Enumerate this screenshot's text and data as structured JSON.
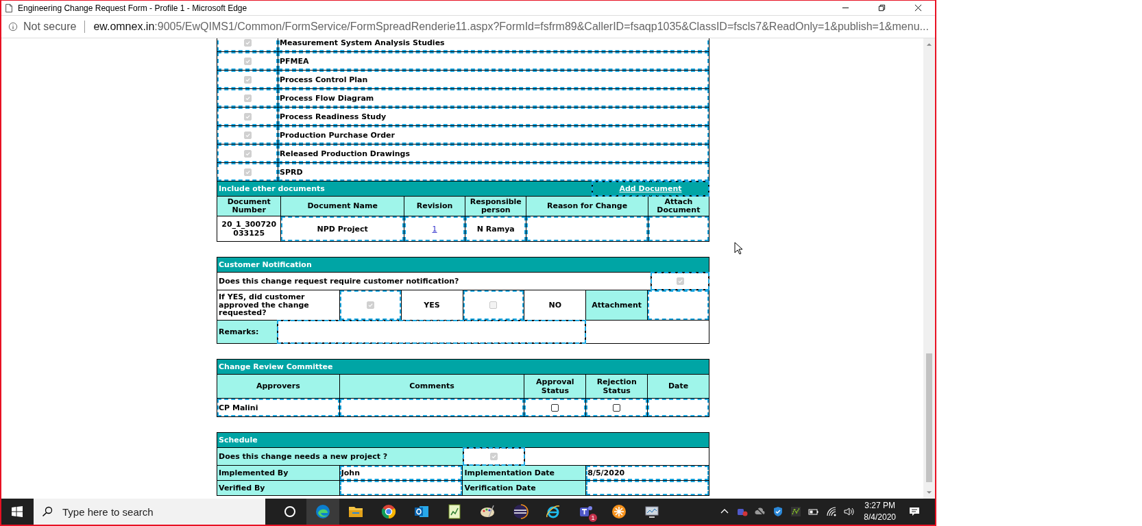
{
  "window": {
    "title": "Engineering Change Request Form - Profile 1 - Microsoft Edge"
  },
  "address_bar": {
    "security": "Not secure",
    "url_host": "ew.omnex.in",
    "url_path": ":9005/EwQIMS1/Common/FormService/FormSpreadRenderie11.aspx?FormId=fsfrm89&CallerID=fsaqp1035&ClassID=fscls7&ReadOnly=1&publish=1&menu..."
  },
  "checklist": [
    {
      "label": "Measurement System Analysis Studies",
      "checked": true,
      "disabled": true
    },
    {
      "label": "PFMEA",
      "checked": true,
      "disabled": true
    },
    {
      "label": "Process Control Plan",
      "checked": true,
      "disabled": true
    },
    {
      "label": "Process Flow Diagram",
      "checked": true,
      "disabled": true
    },
    {
      "label": "Process Readiness Study",
      "checked": true,
      "disabled": true
    },
    {
      "label": "Production Purchase Order",
      "checked": true,
      "disabled": true
    },
    {
      "label": "Released Production Drawings",
      "checked": true,
      "disabled": true
    },
    {
      "label": "SPRD",
      "checked": true,
      "disabled": true
    }
  ],
  "other_documents": {
    "title": "Include other documents",
    "add_button": "Add Document",
    "columns": [
      "Document Number",
      "Document Name",
      "Revision",
      "Responsible person",
      "Reason for Change",
      "Attach Document"
    ],
    "rows": [
      {
        "document_number": "20_1_300720033125",
        "document_name": "NPD Project",
        "revision": "1",
        "responsible_person": "N Ramya"
      }
    ]
  },
  "customer_notification": {
    "title": "Customer Notification",
    "question": "Does this change request require customer notification?",
    "question_checked": true,
    "question_disabled": true,
    "approval_question": "If YES, did customer approved the change requested?",
    "yes_checked": true,
    "yes_disabled": true,
    "yes_label": "YES",
    "no_checked": false,
    "no_disabled": true,
    "no_label": "NO",
    "attachment_label": "Attachment",
    "remarks_label": "Remarks:"
  },
  "review_committee": {
    "title": "Change Review Committee",
    "columns": [
      "Approvers",
      "Comments",
      "Approval Status",
      "Rejection Status",
      "Date"
    ],
    "rows": [
      {
        "approver": "CP Malini",
        "approval_checked": false,
        "approval_disabled": false,
        "rejection_checked": false,
        "rejection_disabled": false
      }
    ]
  },
  "schedule": {
    "title": "Schedule",
    "new_project_question": "Does this change needs a new project ?",
    "new_project_checked": true,
    "new_project_disabled": true,
    "implemented_by_label": "Implemented By",
    "implemented_by": "John",
    "implementation_date_label": "Implementation Date",
    "implementation_date": "8/5/2020",
    "verified_by_label": "Verified By",
    "verification_date_label": "Verification Date"
  },
  "taskbar": {
    "search_placeholder": "Type here to search",
    "teams_badge": "1",
    "time": "3:27 PM",
    "date": "8/4/2020"
  }
}
